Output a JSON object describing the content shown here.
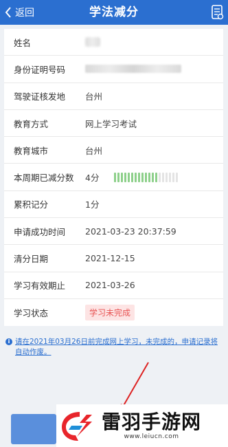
{
  "header": {
    "back_label": "返回",
    "title": "学法减分"
  },
  "rows": [
    {
      "label": "姓名",
      "value": ""
    },
    {
      "label": "身份证明号码",
      "value": ""
    },
    {
      "label": "驾驶证核发地",
      "value": "台州"
    },
    {
      "label": "教育方式",
      "value": "网上学习考试"
    },
    {
      "label": "教育城市",
      "value": "台州"
    },
    {
      "label": "本周期已减分数",
      "value": "4分",
      "progress": {
        "filled": 13,
        "total": 19
      }
    },
    {
      "label": "累积记分",
      "value": "1分"
    },
    {
      "label": "申请成功时间",
      "value": "2021-03-23 20:37:59"
    },
    {
      "label": "清分日期",
      "value": "2021-12-15"
    },
    {
      "label": "学习有效期止",
      "value": "2021-03-26"
    },
    {
      "label": "学习状态",
      "value": "学习未完成"
    }
  ],
  "notice": "请在2021年03月26日前完成网上学习，未完成的，申请记录将自动作废。",
  "watermark": {
    "name": "雷羽手游网",
    "url": "www.leiucn.com"
  },
  "colors": {
    "primary": "#2b6fd0",
    "progress": "#8dd08a",
    "status_bg": "#fde4e4",
    "status_text": "#e85454"
  }
}
